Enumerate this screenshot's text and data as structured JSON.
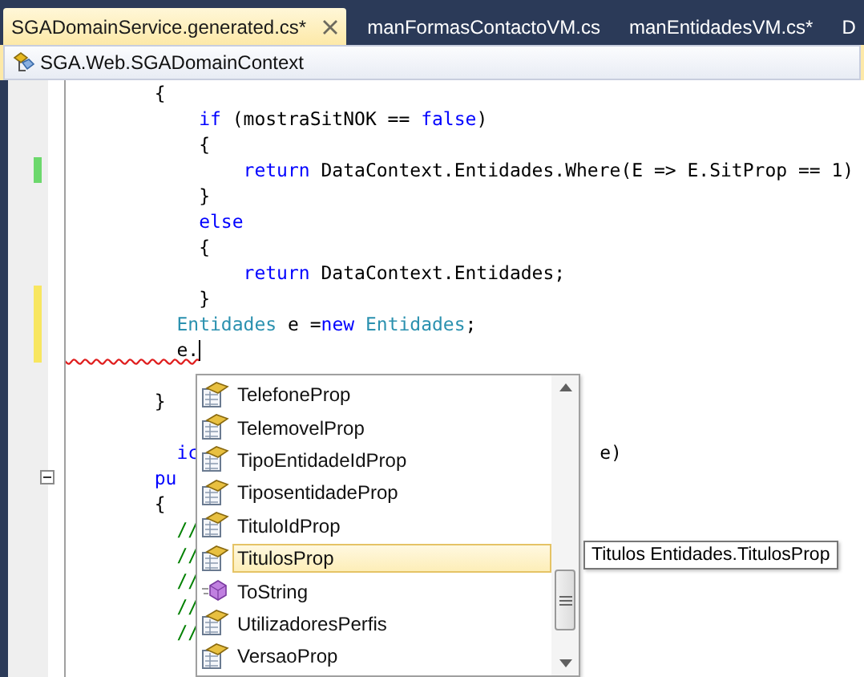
{
  "tabs": [
    {
      "label": "SGADomainService.generated.cs*",
      "selected": true,
      "closable": true
    },
    {
      "label": "manFormasContactoVM.cs",
      "selected": false,
      "closable": false
    },
    {
      "label": "manEntidadesVM.cs*",
      "selected": false,
      "closable": false
    },
    {
      "label": "D",
      "selected": false,
      "closable": false
    }
  ],
  "navigation": {
    "context": "SGA.Web.SGADomainContext"
  },
  "code_lines": [
    {
      "changed": false,
      "tokens": [
        {
          "text": "        {",
          "kind": "plain"
        }
      ]
    },
    {
      "changed": false,
      "tokens": [
        {
          "text": "            if",
          "kind": "keyword"
        },
        {
          "text": " (mostraSitNOK == ",
          "kind": "plain"
        },
        {
          "text": "false",
          "kind": "keyword"
        },
        {
          "text": ")",
          "kind": "plain"
        }
      ]
    },
    {
      "changed": false,
      "tokens": [
        {
          "text": "            {",
          "kind": "plain"
        }
      ]
    },
    {
      "changed": true,
      "saved": true,
      "tokens": [
        {
          "text": "                return",
          "kind": "keyword"
        },
        {
          "text": " DataContext.Entidades.Where(E => E.SitProp == 1)",
          "kind": "plain"
        }
      ]
    },
    {
      "changed": false,
      "tokens": [
        {
          "text": "            }",
          "kind": "plain"
        }
      ]
    },
    {
      "changed": false,
      "tokens": [
        {
          "text": "            else",
          "kind": "keyword"
        }
      ]
    },
    {
      "changed": false,
      "tokens": [
        {
          "text": "            {",
          "kind": "plain"
        }
      ]
    },
    {
      "changed": false,
      "tokens": [
        {
          "text": "                return",
          "kind": "keyword"
        },
        {
          "text": " DataContext.Entidades;",
          "kind": "plain"
        }
      ]
    },
    {
      "changed": true,
      "saved": false,
      "tokens": [
        {
          "text": "            }",
          "kind": "plain"
        }
      ]
    },
    {
      "changed": true,
      "saved": false,
      "tokens": [
        {
          "text": "          Entidades",
          "kind": "type"
        },
        {
          "text": " e =",
          "kind": "plain"
        },
        {
          "text": "new",
          "kind": "keyword"
        },
        {
          "text": " Entidades",
          "kind": "type"
        },
        {
          "text": ";",
          "kind": "plain"
        }
      ]
    },
    {
      "changed": true,
      "saved": false,
      "tokens": [
        {
          "text": "          e.",
          "kind": "error"
        }
      ]
    },
    {
      "changed": false
    },
    {
      "changed": false,
      "tokens": [
        {
          "text": "        }",
          "kind": "plain"
        }
      ]
    },
    {
      "changed": false
    },
    {
      "changed": false,
      "tokens": [
        {
          "text": "          ic",
          "kind": "keyword"
        }
      ],
      "tail": "e)"
    },
    {
      "changed": false,
      "collapsible": true,
      "tokens": [
        {
          "text": "        pu",
          "kind": "keyword"
        }
      ]
    },
    {
      "changed": false,
      "tokens": [
        {
          "text": "        {",
          "kind": "plain"
        }
      ]
    },
    {
      "changed": false,
      "tokens": [
        {
          "text": "          //",
          "kind": "comment"
        }
      ]
    },
    {
      "changed": false,
      "tokens": [
        {
          "text": "          //",
          "kind": "comment"
        }
      ]
    },
    {
      "changed": false,
      "tokens": [
        {
          "text": "          //",
          "kind": "comment"
        }
      ]
    },
    {
      "changed": false,
      "tokens": [
        {
          "text": "          //",
          "kind": "comment"
        }
      ]
    },
    {
      "changed": false,
      "tokens": [
        {
          "text": "          //",
          "kind": "comment"
        }
      ]
    }
  ],
  "completion_list": {
    "items": [
      {
        "label": "TelefoneProp",
        "kind": "property",
        "selected": false
      },
      {
        "label": "TelemovelProp",
        "kind": "property",
        "selected": false
      },
      {
        "label": "TipoEntidadeIdProp",
        "kind": "property",
        "selected": false
      },
      {
        "label": "TiposentidadeProp",
        "kind": "property",
        "selected": false
      },
      {
        "label": "TituloIdProp",
        "kind": "property",
        "selected": false
      },
      {
        "label": "TitulosProp",
        "kind": "property",
        "selected": true
      },
      {
        "label": "ToString",
        "kind": "method",
        "selected": false
      },
      {
        "label": "UtilizadoresPerfis",
        "kind": "property",
        "selected": false
      },
      {
        "label": "VersaoProp",
        "kind": "property",
        "selected": false
      }
    ],
    "tooltip": "Titulos Entidades.TitulosProp"
  }
}
